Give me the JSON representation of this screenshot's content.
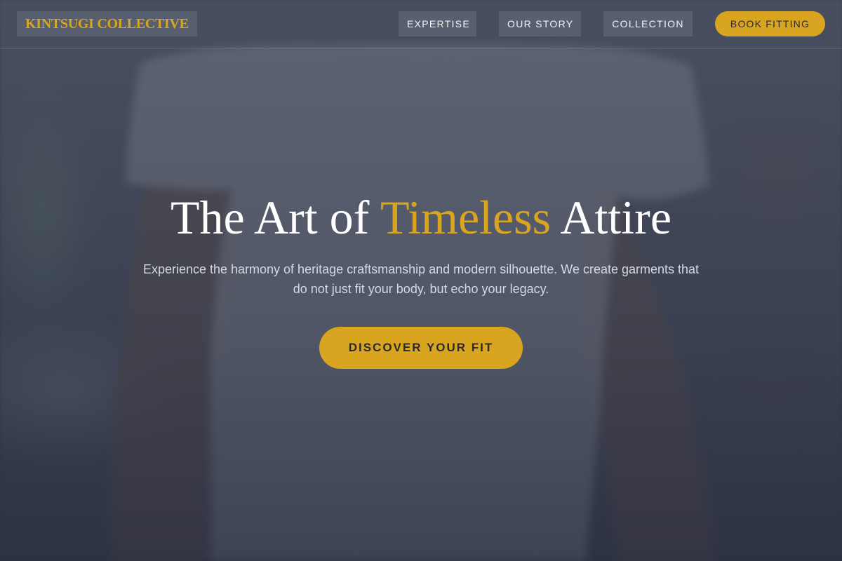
{
  "brand": {
    "name": "KINTSUGI COLLECTIVE",
    "accent_color": "#D9A520"
  },
  "nav": {
    "links": [
      {
        "label": "EXPERTISE"
      },
      {
        "label": "OUR STORY"
      },
      {
        "label": "COLLECTION"
      }
    ],
    "cta_label": "BOOK FITTING"
  },
  "hero": {
    "title_start": "The Art of ",
    "title_accent": "Timeless",
    "title_end": " Attire",
    "subtitle": "Experience the harmony of heritage craftsmanship and modern silhouette. We create garments that do not just fit your body, but echo your legacy.",
    "cta_label": "DISCOVER YOUR FIT"
  },
  "colors": {
    "overlay": "#3B4254",
    "button": "#D9A520",
    "button_text": "#2A2A2A"
  }
}
